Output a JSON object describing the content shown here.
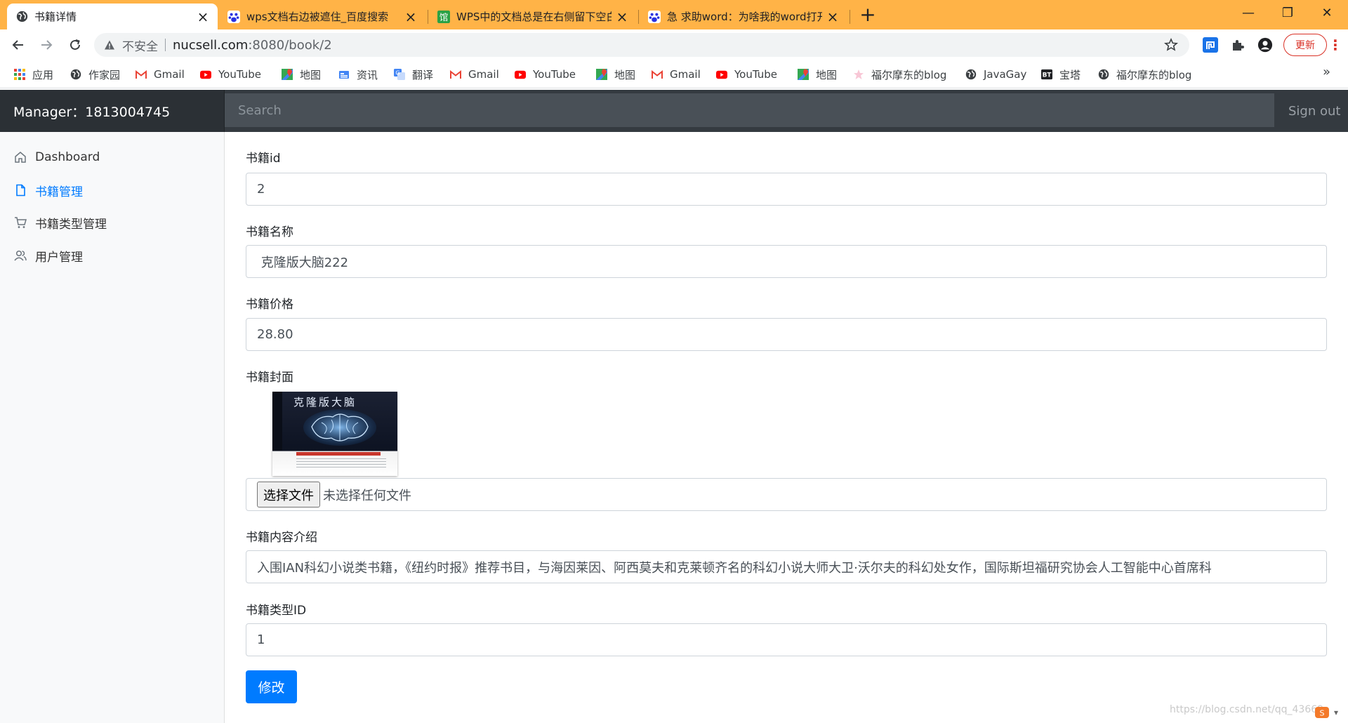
{
  "browser": {
    "tabs": [
      {
        "title": "书籍详情",
        "icon": "globe-icon",
        "active": true
      },
      {
        "title": "wps文档右边被遮住_百度搜索",
        "icon": "baidu-paw-icon",
        "active": false
      },
      {
        "title": "WPS中的文档总是在右侧留下空白",
        "icon": "green-square-icon",
        "active": false
      },
      {
        "title": "急 求助word：为啥我的word打开",
        "icon": "baidu-paw-icon",
        "active": false
      }
    ],
    "new_tab_symbol": "+",
    "window_controls": {
      "minimize": "—",
      "restore": "❐",
      "close": "✕"
    },
    "address": {
      "security_label": "不安全",
      "host": "nucsell.com",
      "path": ":8080/book/2"
    },
    "update_label": "更新",
    "bookmarks": [
      {
        "label": "应用",
        "icon": "apps-grid-icon"
      },
      {
        "label": "作家园",
        "icon": "globe-icon"
      },
      {
        "label": "Gmail",
        "icon": "gmail-icon"
      },
      {
        "label": "YouTube",
        "icon": "youtube-icon"
      },
      {
        "label": "地图",
        "icon": "maps-icon"
      },
      {
        "label": "资讯",
        "icon": "news-icon"
      },
      {
        "label": "翻译",
        "icon": "translate-icon"
      },
      {
        "label": "Gmail",
        "icon": "gmail-icon"
      },
      {
        "label": "YouTube",
        "icon": "youtube-icon"
      },
      {
        "label": "地图",
        "icon": "maps-icon"
      },
      {
        "label": "Gmail",
        "icon": "gmail-icon"
      },
      {
        "label": "YouTube",
        "icon": "youtube-icon"
      },
      {
        "label": "地图",
        "icon": "maps-icon"
      },
      {
        "label": "福尔摩东的blog",
        "icon": "star-icon"
      },
      {
        "label": "JavaGay",
        "icon": "globe-icon"
      },
      {
        "label": "宝塔",
        "icon": "bt-icon"
      },
      {
        "label": "福尔摩东的blog",
        "icon": "globe-icon"
      }
    ],
    "bookmarks_more": "»"
  },
  "app": {
    "brand": "Manager：1813004745",
    "search_placeholder": "Search",
    "signout": "Sign out",
    "sidebar": [
      {
        "label": "Dashboard",
        "icon": "home-icon",
        "active": false
      },
      {
        "label": "书籍管理",
        "icon": "file-icon",
        "active": true
      },
      {
        "label": "书籍类型管理",
        "icon": "cart-icon",
        "active": false
      },
      {
        "label": "用户管理",
        "icon": "users-icon",
        "active": false
      }
    ],
    "form": {
      "id_label": "书籍id",
      "id_value": "2",
      "name_label": "书籍名称",
      "name_value": " 克隆版大脑222",
      "price_label": "书籍价格",
      "price_value": "28.80",
      "cover_label": "书籍封面",
      "cover_title": "克隆版大脑",
      "file_button": "选择文件",
      "file_status": "未选择任何文件",
      "intro_label": "书籍内容介绍",
      "intro_value": "入围IAN科幻小说类书籍，《纽约时报》推荐书目，与海因莱因、阿西莫夫和克莱顿齐名的科幻小说大师大卫·沃尔夫的科幻处女作，国际斯坦福研究协会人工智能中心首席科",
      "type_label": "书籍类型ID",
      "type_value": "1",
      "submit_label": "修改"
    },
    "watermark": "https://blog.csdn.net/qq_43669"
  },
  "colors": {
    "tabstrip": "#ffb347",
    "navbar": "#343a40",
    "brand_bg": "#2b3035",
    "search_bg": "#495057",
    "primary": "#007bff",
    "sidebar_bg": "#f8f9fa"
  }
}
